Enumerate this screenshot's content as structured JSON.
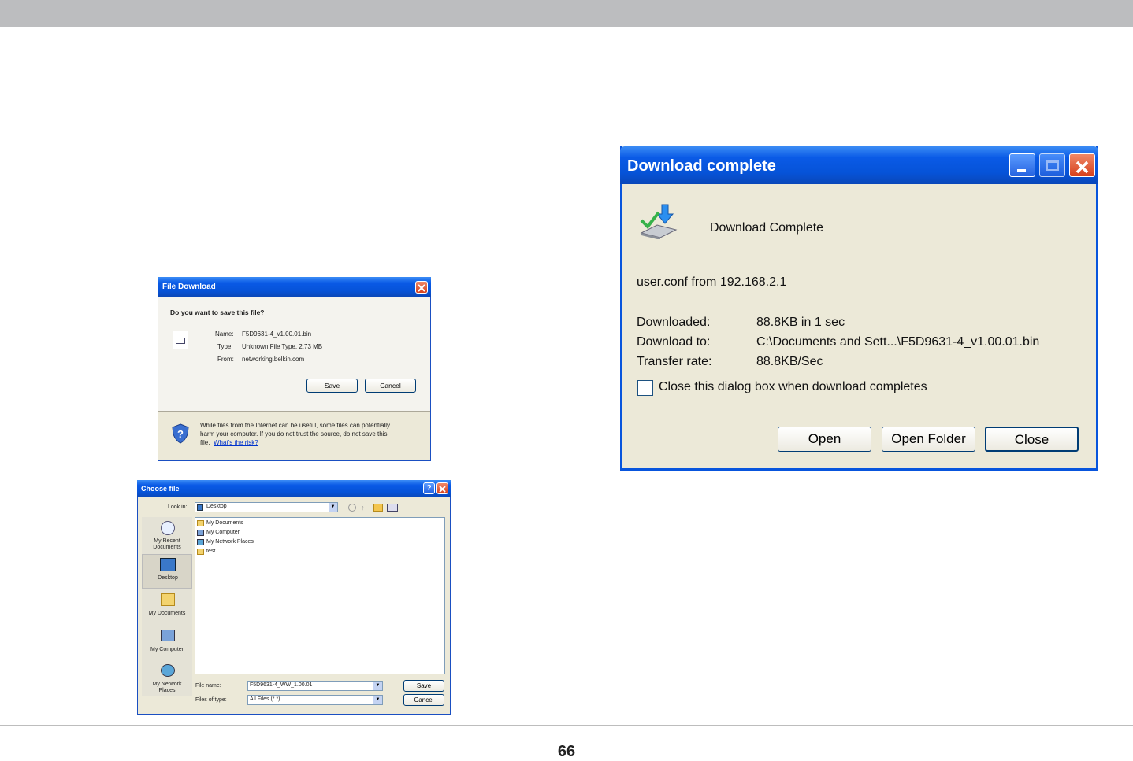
{
  "page_number": "66",
  "file_download": {
    "title": "File Download",
    "question": "Do you want to save this file?",
    "name_label": "Name:",
    "name_value": "F5D9631-4_v1.00.01.bin",
    "type_label": "Type:",
    "type_value": "Unknown File Type, 2.73 MB",
    "from_label": "From:",
    "from_value": "networking.belkin.com",
    "save_label": "Save",
    "cancel_label": "Cancel",
    "warning_line1": "While files from the Internet can be useful, some files can potentially",
    "warning_line2": "harm your computer. If you do not trust the source, do not save this",
    "warning_line3": "file.",
    "risk_link": "What's the risk?"
  },
  "choose_file": {
    "title": "Choose file",
    "look_in_label": "Look in:",
    "look_in_value": "Desktop",
    "places": [
      {
        "label1": "My Recent",
        "label2": "Documents"
      },
      {
        "label1": "Desktop",
        "label2": ""
      },
      {
        "label1": "My Documents",
        "label2": ""
      },
      {
        "label1": "My Computer",
        "label2": ""
      },
      {
        "label1": "My Network",
        "label2": "Places"
      }
    ],
    "files": [
      "My Documents",
      "My Computer",
      "My Network Places",
      "test"
    ],
    "file_name_label": "File name:",
    "file_name_value": "F5D9631-4_WW_1.00.01",
    "file_type_label": "Files of type:",
    "file_type_value": "All Files (*.*)",
    "save_label": "Save",
    "cancel_label": "Cancel"
  },
  "download_complete": {
    "title": "Download complete",
    "heading": "Download Complete",
    "source": "user.conf from 192.168.2.1",
    "downloaded_label": "Downloaded:",
    "downloaded_value": "88.8KB in 1 sec",
    "download_to_label": "Download to:",
    "download_to_value": "C:\\Documents and Sett...\\F5D9631-4_v1.00.01.bin",
    "rate_label": "Transfer rate:",
    "rate_value": "88.8KB/Sec",
    "checkbox_label": "Close this dialog box when download completes",
    "checkbox_checked": false,
    "open_label": "Open",
    "open_folder_label": "Open Folder",
    "close_label": "Close"
  }
}
